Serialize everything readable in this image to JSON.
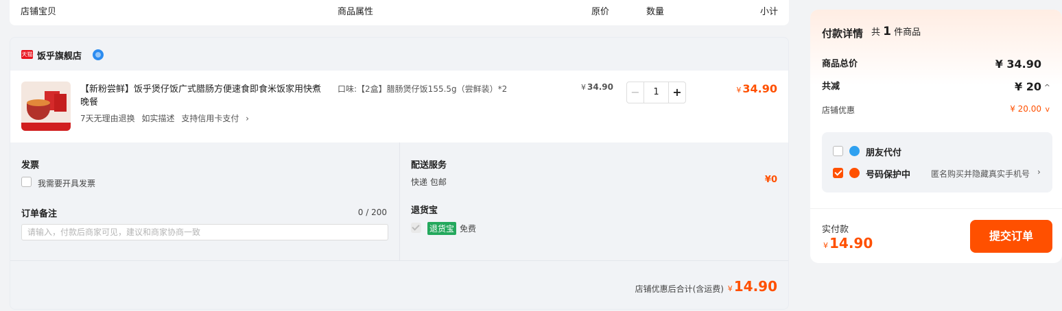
{
  "columns": {
    "shop_item": "店铺宝贝",
    "attributes": "商品属性",
    "original_price": "原价",
    "quantity": "数量",
    "subtotal": "小计"
  },
  "shop": {
    "badge": "天猫",
    "name": "饭乎旗舰店"
  },
  "item": {
    "title": "【新粉尝鲜】饭乎煲仔饭广式腊肠方便速食即食米饭家用快煮晚餐",
    "tags": [
      "7天无理由退换",
      "如实描述",
      "支持信用卡支付"
    ],
    "tags_arrow": "›",
    "attribute": "口味:【2盒】腊肠煲仔饭155.5g（尝鲜装）*2",
    "price": "34.90",
    "yen": "¥",
    "quantity": "1",
    "minus": "−",
    "plus": "+",
    "subtotal": "34.90"
  },
  "invoice": {
    "title": "发票",
    "option": "我需要开具发票"
  },
  "remark": {
    "title": "订单备注",
    "counter": "0 / 200",
    "placeholder": "请输入，付款后商家可见，建议和商家协商一致"
  },
  "delivery": {
    "title": "配送服务",
    "method": "快递 包邮",
    "fee": "¥0"
  },
  "return_insurance": {
    "title": "退货宝",
    "badge": "退货宝",
    "status": "免费"
  },
  "order_total": {
    "label": "店铺优惠后合计(含运费)",
    "yen": "¥",
    "value": "14.90"
  },
  "payment": {
    "title": "付款详情",
    "count_prefix": "共",
    "count": "1",
    "count_suffix": "件商品",
    "total_label": "商品总价",
    "total_value": "¥ 34.90",
    "discount_label": "共减",
    "discount_value": "¥ 20",
    "discount_chev": "^",
    "shop_discount_label": "店铺优惠",
    "shop_discount_value": "¥ 20.00",
    "shop_discount_chev": "v",
    "friend_pay": "朋友代付",
    "number_protect": "号码保护中",
    "number_protect_desc": "匿名购买并隐藏真实手机号",
    "number_protect_arrow": "›",
    "actual_label": "实付款",
    "actual_yen": "¥",
    "actual_value": "14.90",
    "submit": "提交订单"
  },
  "colors": {
    "accent": "#ff5000",
    "tmall_red": "#e8141e",
    "insurance_green": "#24a85d",
    "friend_pay_blue": "#2fa1f0"
  }
}
